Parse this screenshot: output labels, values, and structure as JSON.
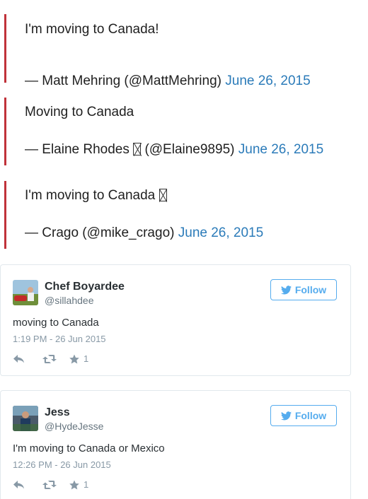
{
  "blockquotes": [
    {
      "text": "I'm moving to Canada!",
      "attribution": "— Matt Mehring (@MattMehring)",
      "date": "June 26, 2015"
    },
    {
      "text": "Moving to Canada",
      "attribution_before_glyph": "— Elaine Rhodes",
      "attribution_after_glyph": "(@Elaine9895)",
      "date": "June 26, 2015"
    },
    {
      "text": "I'm moving to Canada",
      "attribution": "— Crago (@mike_crago)",
      "date": "June 26, 2015"
    }
  ],
  "tweets": [
    {
      "name": "Chef Boyardee",
      "handle": "@sillahdee",
      "follow_label": "Follow",
      "text": "moving to Canada",
      "time": "1:19 PM - 26 Jun 2015",
      "favorites": "1"
    },
    {
      "name": "Jess",
      "handle": "@HydeJesse",
      "follow_label": "Follow",
      "text": "I'm moving to Canada or Mexico",
      "time": "12:26 PM - 26 Jun 2015",
      "favorites": "1"
    }
  ],
  "colors": {
    "quote_border": "#c0323a",
    "link": "#2b7bb9",
    "twitter_blue": "#55acee",
    "muted": "#8899a6"
  },
  "icons": [
    "twitter-bird-icon",
    "reply-icon",
    "retweet-icon",
    "favorite-star-icon",
    "missing-glyph-icon"
  ]
}
